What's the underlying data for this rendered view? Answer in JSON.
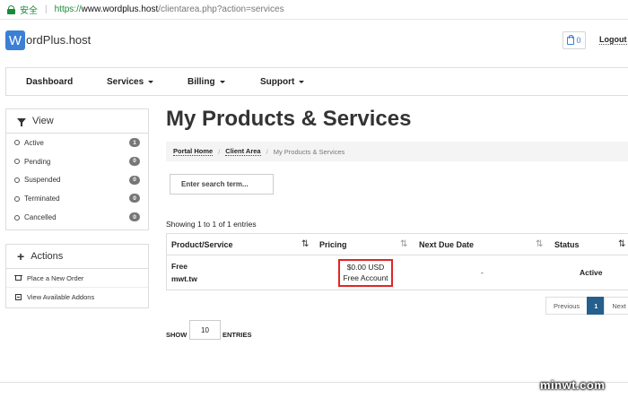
{
  "browser": {
    "secure_label": "安全",
    "url_proto": "https://",
    "url_host": "www.wordplus.host",
    "url_path": "/clientarea.php?action=services"
  },
  "header": {
    "logo_letter": "W",
    "logo_text": "ordPlus.host",
    "cart_count": "0",
    "logout_label": "Logout"
  },
  "nav": {
    "items": [
      {
        "label": "Dashboard"
      },
      {
        "label": "Services"
      },
      {
        "label": "Billing"
      },
      {
        "label": "Support"
      }
    ]
  },
  "sidebar": {
    "view_title": "View",
    "filters": [
      {
        "label": "Active",
        "count": "1"
      },
      {
        "label": "Pending",
        "count": "0"
      },
      {
        "label": "Suspended",
        "count": "0"
      },
      {
        "label": "Terminated",
        "count": "0"
      },
      {
        "label": "Cancelled",
        "count": "0"
      }
    ],
    "actions_title": "Actions",
    "actions": [
      {
        "label": "Place a New Order"
      },
      {
        "label": "View Available Addons"
      }
    ]
  },
  "main": {
    "title": "My Products & Services",
    "breadcrumb": [
      "Portal Home",
      "Client Area",
      "My Products & Services"
    ],
    "search_placeholder": "Enter search term...",
    "showing_text": "Showing 1 to 1 of 1 entries",
    "columns": [
      "Product/Service",
      "Pricing",
      "Next Due Date",
      "Status"
    ],
    "rows": [
      {
        "product": "Free",
        "domain": "mwt.tw",
        "price": "$0.00 USD",
        "billing_cycle": "Free Account",
        "next_due": "-",
        "status": "Active"
      }
    ],
    "pagination": {
      "previous": "Previous",
      "current": "1",
      "next": "Next"
    },
    "show_label": "SHOW",
    "show_value": "10",
    "entries_label": "ENTRIES"
  },
  "watermark": "minwt.com"
}
